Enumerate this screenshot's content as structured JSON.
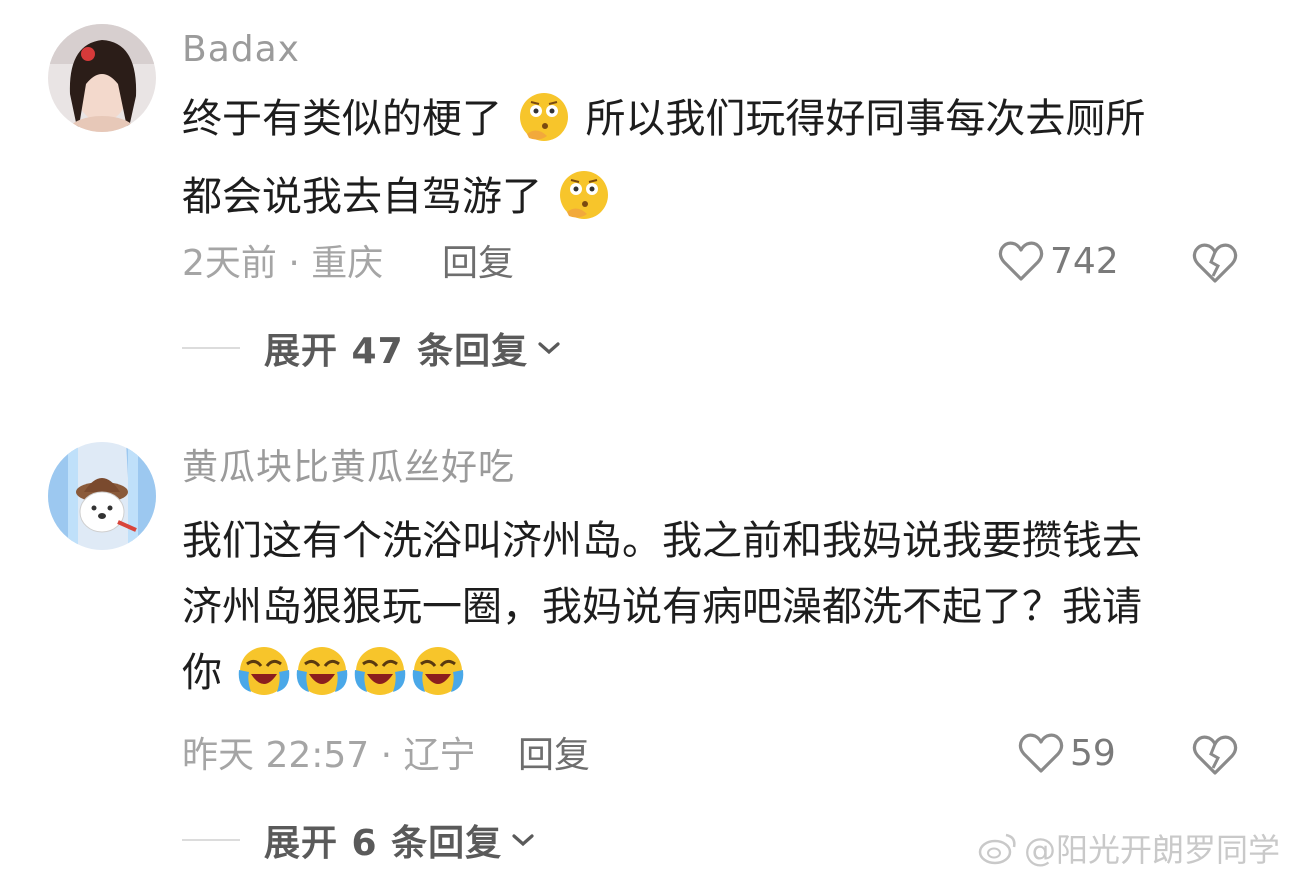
{
  "comments": [
    {
      "username": "Badax",
      "lines": [
        "终于有类似的梗了",
        "所以我们玩得好同事每次去厕所",
        "都会说我去自驾游了"
      ],
      "time_location": "2天前 · 重庆",
      "reply_label": "回复",
      "likes": "742",
      "expand_label": "展开 47 条回复",
      "avatar_icon": "profile-photo-woman"
    },
    {
      "username": "黄瓜块比黄瓜丝好吃",
      "lines": [
        "我们这有个洗浴叫济州岛。我之前和我妈说我要攒钱去",
        "济州岛狠狠玩一圈，我妈说有病吧澡都洗不起了？我请",
        "你"
      ],
      "time_location": "昨天 22:57 · 辽宁",
      "reply_label": "回复",
      "likes": "59",
      "expand_label": "展开 6 条回复",
      "avatar_icon": "cartoon-dog-avatar"
    }
  ],
  "watermark": "@阳光开朗罗同学",
  "colors": {
    "text": "#1d1d1d",
    "muted": "#a5a5a5",
    "emoji_yellow": "#f7c52b",
    "emoji_blue": "#4aa8e8"
  }
}
